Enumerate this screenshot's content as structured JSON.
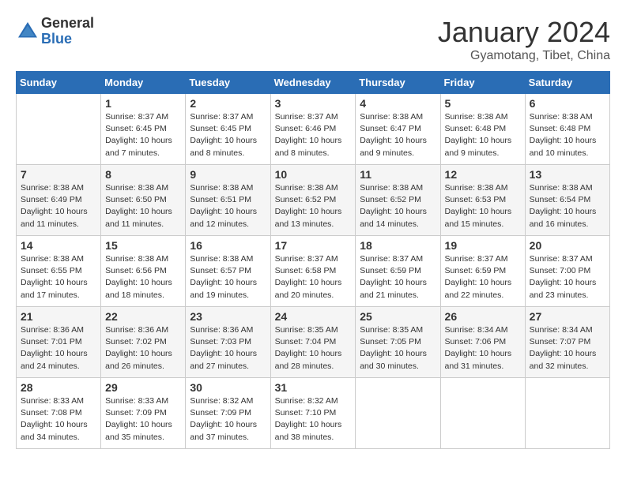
{
  "header": {
    "logo_general": "General",
    "logo_blue": "Blue",
    "month_title": "January 2024",
    "subtitle": "Gyamotang, Tibet, China"
  },
  "calendar": {
    "days_of_week": [
      "Sunday",
      "Monday",
      "Tuesday",
      "Wednesday",
      "Thursday",
      "Friday",
      "Saturday"
    ],
    "weeks": [
      [
        {
          "day": "",
          "info": ""
        },
        {
          "day": "1",
          "info": "Sunrise: 8:37 AM\nSunset: 6:45 PM\nDaylight: 10 hours\nand 7 minutes."
        },
        {
          "day": "2",
          "info": "Sunrise: 8:37 AM\nSunset: 6:45 PM\nDaylight: 10 hours\nand 8 minutes."
        },
        {
          "day": "3",
          "info": "Sunrise: 8:37 AM\nSunset: 6:46 PM\nDaylight: 10 hours\nand 8 minutes."
        },
        {
          "day": "4",
          "info": "Sunrise: 8:38 AM\nSunset: 6:47 PM\nDaylight: 10 hours\nand 9 minutes."
        },
        {
          "day": "5",
          "info": "Sunrise: 8:38 AM\nSunset: 6:48 PM\nDaylight: 10 hours\nand 9 minutes."
        },
        {
          "day": "6",
          "info": "Sunrise: 8:38 AM\nSunset: 6:48 PM\nDaylight: 10 hours\nand 10 minutes."
        }
      ],
      [
        {
          "day": "7",
          "info": "Sunrise: 8:38 AM\nSunset: 6:49 PM\nDaylight: 10 hours\nand 11 minutes."
        },
        {
          "day": "8",
          "info": "Sunrise: 8:38 AM\nSunset: 6:50 PM\nDaylight: 10 hours\nand 11 minutes."
        },
        {
          "day": "9",
          "info": "Sunrise: 8:38 AM\nSunset: 6:51 PM\nDaylight: 10 hours\nand 12 minutes."
        },
        {
          "day": "10",
          "info": "Sunrise: 8:38 AM\nSunset: 6:52 PM\nDaylight: 10 hours\nand 13 minutes."
        },
        {
          "day": "11",
          "info": "Sunrise: 8:38 AM\nSunset: 6:52 PM\nDaylight: 10 hours\nand 14 minutes."
        },
        {
          "day": "12",
          "info": "Sunrise: 8:38 AM\nSunset: 6:53 PM\nDaylight: 10 hours\nand 15 minutes."
        },
        {
          "day": "13",
          "info": "Sunrise: 8:38 AM\nSunset: 6:54 PM\nDaylight: 10 hours\nand 16 minutes."
        }
      ],
      [
        {
          "day": "14",
          "info": "Sunrise: 8:38 AM\nSunset: 6:55 PM\nDaylight: 10 hours\nand 17 minutes."
        },
        {
          "day": "15",
          "info": "Sunrise: 8:38 AM\nSunset: 6:56 PM\nDaylight: 10 hours\nand 18 minutes."
        },
        {
          "day": "16",
          "info": "Sunrise: 8:38 AM\nSunset: 6:57 PM\nDaylight: 10 hours\nand 19 minutes."
        },
        {
          "day": "17",
          "info": "Sunrise: 8:37 AM\nSunset: 6:58 PM\nDaylight: 10 hours\nand 20 minutes."
        },
        {
          "day": "18",
          "info": "Sunrise: 8:37 AM\nSunset: 6:59 PM\nDaylight: 10 hours\nand 21 minutes."
        },
        {
          "day": "19",
          "info": "Sunrise: 8:37 AM\nSunset: 6:59 PM\nDaylight: 10 hours\nand 22 minutes."
        },
        {
          "day": "20",
          "info": "Sunrise: 8:37 AM\nSunset: 7:00 PM\nDaylight: 10 hours\nand 23 minutes."
        }
      ],
      [
        {
          "day": "21",
          "info": "Sunrise: 8:36 AM\nSunset: 7:01 PM\nDaylight: 10 hours\nand 24 minutes."
        },
        {
          "day": "22",
          "info": "Sunrise: 8:36 AM\nSunset: 7:02 PM\nDaylight: 10 hours\nand 26 minutes."
        },
        {
          "day": "23",
          "info": "Sunrise: 8:36 AM\nSunset: 7:03 PM\nDaylight: 10 hours\nand 27 minutes."
        },
        {
          "day": "24",
          "info": "Sunrise: 8:35 AM\nSunset: 7:04 PM\nDaylight: 10 hours\nand 28 minutes."
        },
        {
          "day": "25",
          "info": "Sunrise: 8:35 AM\nSunset: 7:05 PM\nDaylight: 10 hours\nand 30 minutes."
        },
        {
          "day": "26",
          "info": "Sunrise: 8:34 AM\nSunset: 7:06 PM\nDaylight: 10 hours\nand 31 minutes."
        },
        {
          "day": "27",
          "info": "Sunrise: 8:34 AM\nSunset: 7:07 PM\nDaylight: 10 hours\nand 32 minutes."
        }
      ],
      [
        {
          "day": "28",
          "info": "Sunrise: 8:33 AM\nSunset: 7:08 PM\nDaylight: 10 hours\nand 34 minutes."
        },
        {
          "day": "29",
          "info": "Sunrise: 8:33 AM\nSunset: 7:09 PM\nDaylight: 10 hours\nand 35 minutes."
        },
        {
          "day": "30",
          "info": "Sunrise: 8:32 AM\nSunset: 7:09 PM\nDaylight: 10 hours\nand 37 minutes."
        },
        {
          "day": "31",
          "info": "Sunrise: 8:32 AM\nSunset: 7:10 PM\nDaylight: 10 hours\nand 38 minutes."
        },
        {
          "day": "",
          "info": ""
        },
        {
          "day": "",
          "info": ""
        },
        {
          "day": "",
          "info": ""
        }
      ]
    ]
  }
}
